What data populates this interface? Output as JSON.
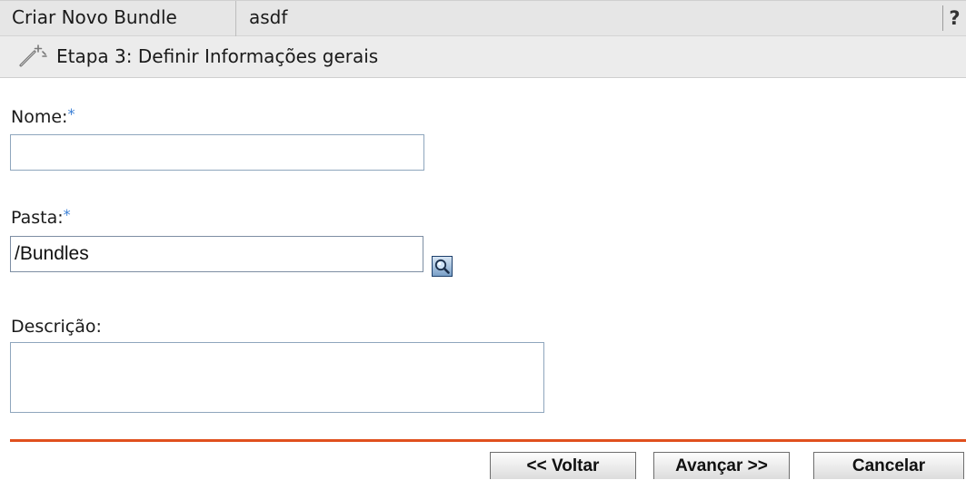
{
  "header": {
    "title": "Criar Novo Bundle",
    "bundle_name": "asdf",
    "help_label": "?"
  },
  "step": {
    "icon": "wand-icon",
    "title": "Etapa 3: Definir Informações gerais"
  },
  "form": {
    "name": {
      "label": "Nome:",
      "required_mark": "*",
      "value": ""
    },
    "folder": {
      "label": "Pasta:",
      "required_mark": "*",
      "value": "/Bundles",
      "browse_icon": "search-icon"
    },
    "description": {
      "label": "Descrição:",
      "value": ""
    }
  },
  "buttons": {
    "back": "<< Voltar",
    "next": "Avançar >>",
    "cancel": "Cancelar"
  },
  "colors": {
    "accent": "#e0501e",
    "required": "#3a7fd5",
    "header_bg": "#e6e6e6",
    "input_border": "#8fa6bd"
  }
}
